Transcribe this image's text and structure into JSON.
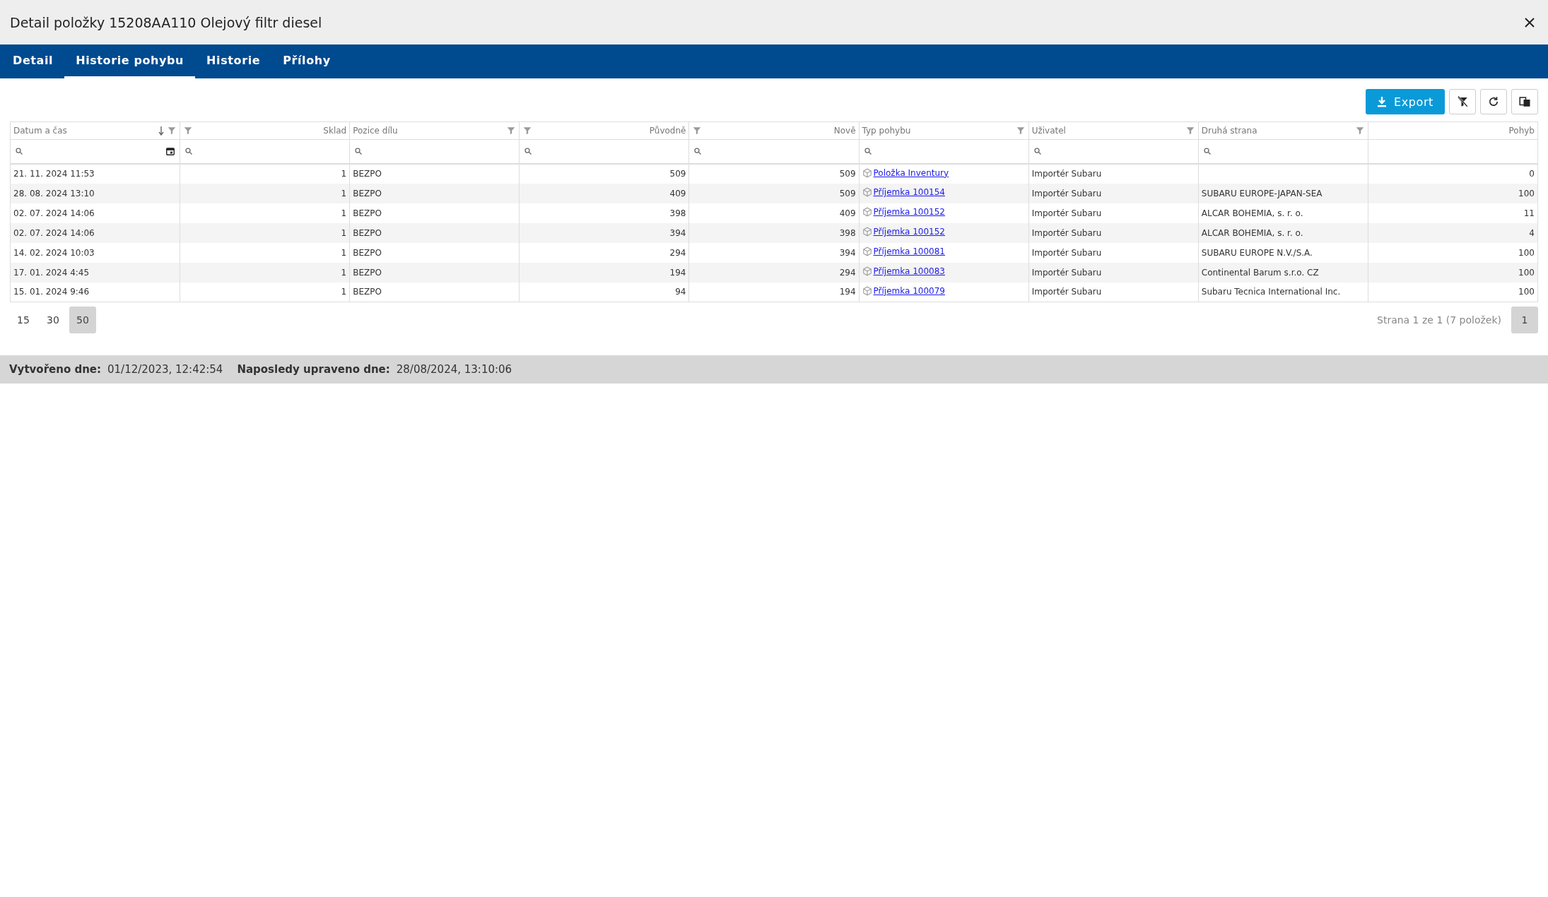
{
  "window": {
    "title": "Detail položky 15208AA110 Olejový filtr diesel"
  },
  "tabs": [
    {
      "label": "Detail",
      "selected": false
    },
    {
      "label": "Historie pohybu",
      "selected": true
    },
    {
      "label": "Historie",
      "selected": false
    },
    {
      "label": "Přílohy",
      "selected": false
    }
  ],
  "toolbar": {
    "export_label": "Export"
  },
  "table": {
    "columns": [
      {
        "label": "Datum a čas",
        "kind": "date"
      },
      {
        "label": "Sklad",
        "kind": "number"
      },
      {
        "label": "Pozice dílu",
        "kind": "text"
      },
      {
        "label": "Původně",
        "kind": "number"
      },
      {
        "label": "Nově",
        "kind": "number"
      },
      {
        "label": "Typ pohybu",
        "kind": "link"
      },
      {
        "label": "Uživatel",
        "kind": "text"
      },
      {
        "label": "Druhá strana",
        "kind": "text"
      },
      {
        "label": "Pohyb",
        "kind": "total"
      }
    ],
    "rows": [
      [
        "21. 11. 2024 11:53",
        "1",
        "BEZPO",
        "509",
        "509",
        "Položka Inventury",
        "Importér Subaru",
        "",
        "0"
      ],
      [
        "28. 08. 2024 13:10",
        "1",
        "BEZPO",
        "409",
        "509",
        "Příjemka 100154",
        "Importér Subaru",
        "SUBARU EUROPE-JAPAN-SEA",
        "100"
      ],
      [
        "02. 07. 2024 14:06",
        "1",
        "BEZPO",
        "398",
        "409",
        "Příjemka 100152",
        "Importér Subaru",
        "ALCAR BOHEMIA, s. r. o.",
        "11"
      ],
      [
        "02. 07. 2024 14:06",
        "1",
        "BEZPO",
        "394",
        "398",
        "Příjemka 100152",
        "Importér Subaru",
        "ALCAR BOHEMIA, s. r. o.",
        "4"
      ],
      [
        "14. 02. 2024 10:03",
        "1",
        "BEZPO",
        "294",
        "394",
        "Příjemka 100081",
        "Importér Subaru",
        "SUBARU EUROPE N.V./S.A.",
        "100"
      ],
      [
        "17. 01. 2024 4:45",
        "1",
        "BEZPO",
        "194",
        "294",
        "Příjemka 100083",
        "Importér Subaru",
        "Continental Barum s.r.o. CZ",
        "100"
      ],
      [
        "15. 01. 2024 9:46",
        "1",
        "BEZPO",
        "94",
        "194",
        "Příjemka 100079",
        "Importér Subaru",
        "Subaru Tecnica International Inc.",
        "100"
      ]
    ]
  },
  "pager": {
    "sizes": [
      {
        "label": "15",
        "selected": false
      },
      {
        "label": "30",
        "selected": false
      },
      {
        "label": "50",
        "selected": true
      }
    ],
    "info": "Strana 1 ze 1 (7 položek)",
    "pages": [
      {
        "label": "1",
        "selected": true
      }
    ]
  },
  "footer": [
    {
      "label": "Vytvořeno dne:",
      "value": "01/12/2023, 12:42:54"
    },
    {
      "label": "Naposledy upraveno dne:",
      "value": "28/08/2024, 13:10:06"
    }
  ]
}
